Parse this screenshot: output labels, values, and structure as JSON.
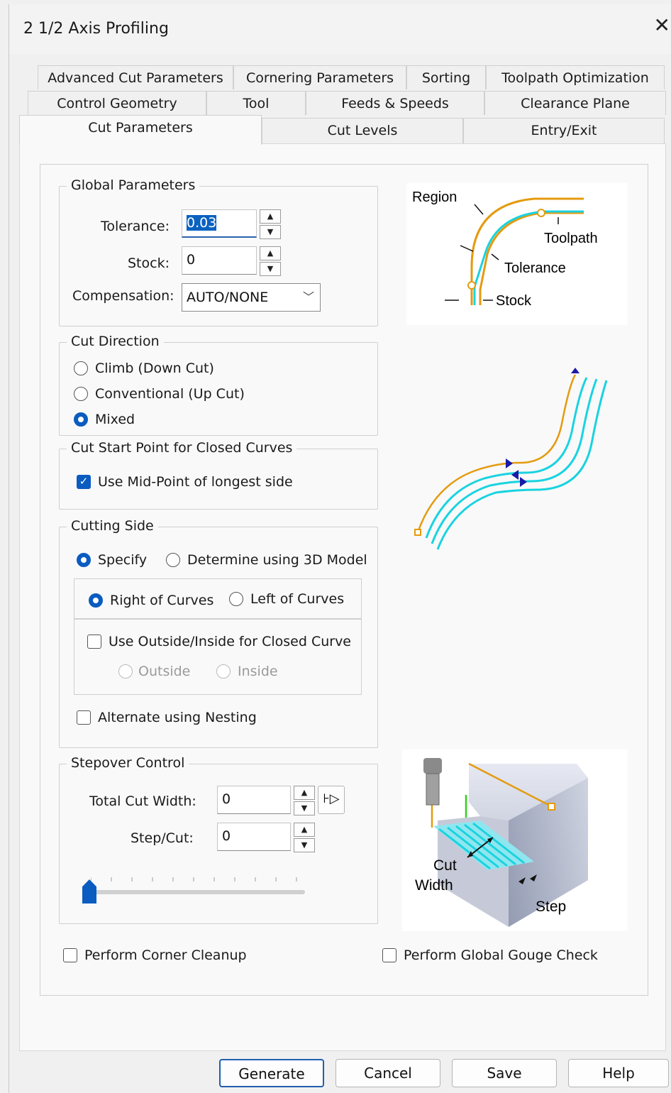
{
  "window": {
    "title": "2 1/2 Axis Profiling",
    "close": "✕"
  },
  "tabs": {
    "row1": [
      "Advanced Cut Parameters",
      "Cornering Parameters",
      "Sorting",
      "Toolpath Optimization"
    ],
    "row2": [
      "Control Geometry",
      "Tool",
      "Feeds & Speeds",
      "Clearance Plane"
    ],
    "row3": [
      "Cut Parameters",
      "Cut Levels",
      "Entry/Exit"
    ],
    "active": "Cut Parameters"
  },
  "global": {
    "title": "Global Parameters",
    "tolerance_label": "Tolerance:",
    "tolerance_value": "0.03",
    "stock_label": "Stock:",
    "stock_value": "0",
    "compensation_label": "Compensation:",
    "compensation_value": "AUTO/NONE"
  },
  "diagram1": {
    "region": "Region",
    "toolpath": "Toolpath",
    "tolerance": "Tolerance",
    "stock": "Stock"
  },
  "cut_direction": {
    "title": "Cut Direction",
    "options": [
      "Climb (Down Cut)",
      "Conventional (Up Cut)",
      "Mixed"
    ],
    "selected": "Mixed"
  },
  "cut_start": {
    "title": "Cut Start Point for Closed Curves",
    "midpoint_label": "Use Mid-Point of longest side",
    "midpoint_checked": true
  },
  "cutting_side": {
    "title": "Cutting Side",
    "specify": "Specify",
    "determine": "Determine using 3D Model",
    "right": "Right of Curves",
    "left": "Left of Curves",
    "outside_inside_label": "Use Outside/Inside for Closed Curve",
    "outside": "Outside",
    "inside": "Inside",
    "nesting": "Alternate using Nesting"
  },
  "stepover": {
    "title": "Stepover Control",
    "total_label": "Total Cut Width:",
    "total_value": "0",
    "step_label": "Step/Cut:",
    "step_value": "0",
    "slider_value": 0
  },
  "diagram3": {
    "cut": "Cut",
    "width": "Width",
    "step": "Step"
  },
  "bottom": {
    "corner": "Perform Corner Cleanup",
    "gouge": "Perform Global Gouge Check"
  },
  "buttons": {
    "generate": "Generate",
    "cancel": "Cancel",
    "save": "Save",
    "help": "Help"
  },
  "colors": {
    "accent": "#0a5cc0",
    "orange": "#e49b0f",
    "cyan": "#19d3e0",
    "blue_arrow": "#1a1aa8"
  }
}
